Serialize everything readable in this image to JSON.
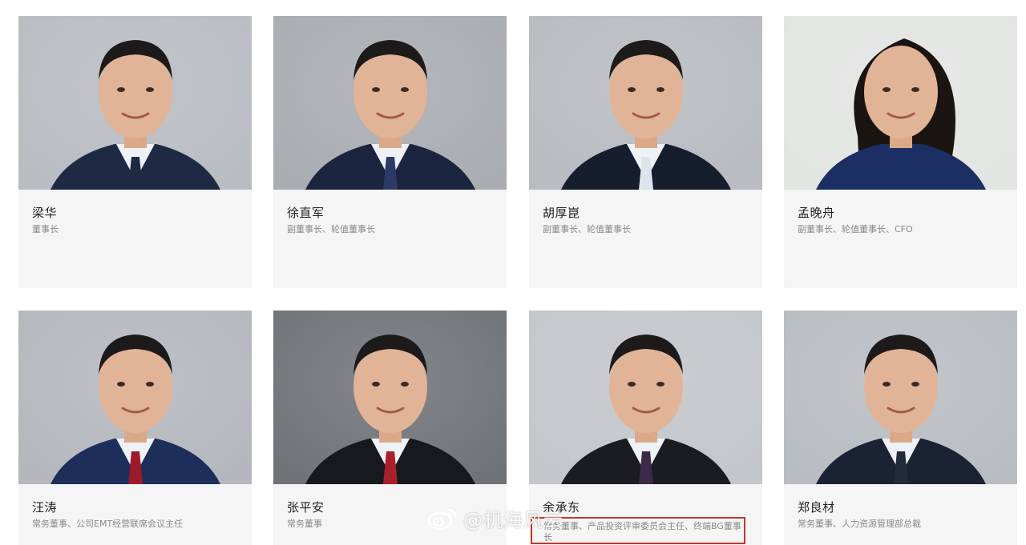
{
  "cards": [
    {
      "name": "梁华",
      "title": "董事长",
      "bg": "#b9bcc2",
      "suit": "#1e2a44",
      "tie": "#1e2a44"
    },
    {
      "name": "徐直军",
      "title": "副董事长、轮值董事长",
      "bg": "#a9acb1",
      "suit": "#1b2540",
      "tie": "#2b3b66"
    },
    {
      "name": "胡厚崑",
      "title": "副董事长、轮值董事长",
      "bg": "#b8bbc0",
      "suit": "#161d2e",
      "tie": "#dfe4ec"
    },
    {
      "name": "孟晚舟",
      "title": "副董事长、轮值董事长、CFO",
      "bg": "#e3e5e3",
      "suit": "#1c2f64",
      "tie": "#1c2f64"
    },
    {
      "name": "汪涛",
      "title": "常务董事、公司EMT经营联席会议主任",
      "bg": "#b4b8be",
      "suit": "#1d2e5a",
      "tie": "#9b1b2a"
    },
    {
      "name": "张平安",
      "title": "常务董事",
      "bg": "#6f7378",
      "suit": "#17191f",
      "tie": "#a8202c"
    },
    {
      "name": "余承东",
      "title": "",
      "bg": "#c3c6ca",
      "suit": "#1a1c22",
      "tie": "#3b2a4a"
    },
    {
      "name": "郑良材",
      "title": "常务董事、人力资源管理部总裁",
      "bg": "#b9bdc2",
      "suit": "#1b2233",
      "tie": "#232a3a"
    }
  ],
  "highlight": {
    "text": "常务董事、产品投资评审委员会主任、终端BG董事长"
  },
  "watermark": {
    "text": "@机海风云",
    "icon": "weibo-icon"
  }
}
